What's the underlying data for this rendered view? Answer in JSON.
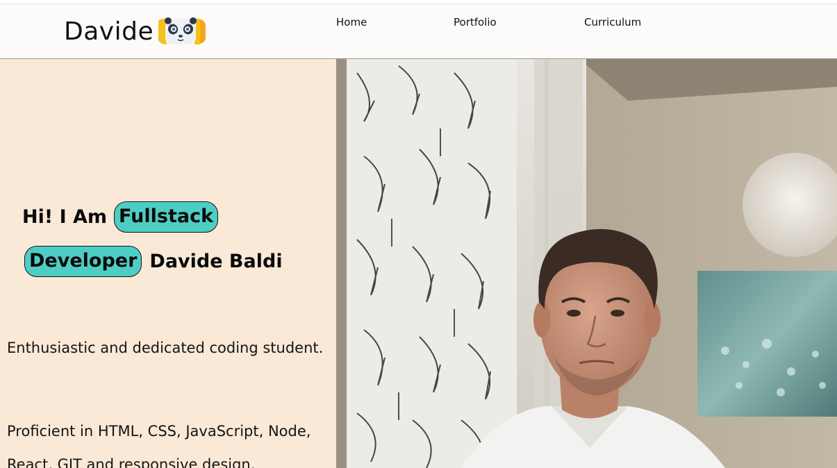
{
  "header": {
    "brand": "Davide",
    "logo_icon": "panda-face-icon",
    "nav": [
      {
        "label": "Home"
      },
      {
        "label": "Portfolio"
      },
      {
        "label": "Curriculum"
      }
    ]
  },
  "hero": {
    "greeting": "Hi! I Am",
    "highlight_1": "Fullstack",
    "highlight_2": "Developer",
    "name": "Davide Baldi",
    "paragraph_1": "Enthusiastic and dedicated coding student.",
    "paragraph_2": "Proficient in HTML, CSS, JavaScript, Node, React, GIT and responsive design.",
    "photo": "profile-photo"
  },
  "colors": {
    "header_bg": "#fdfafa",
    "hero_left_bg": "#f9e9d6",
    "highlight": "#4ecdc4",
    "text": "#111111"
  }
}
